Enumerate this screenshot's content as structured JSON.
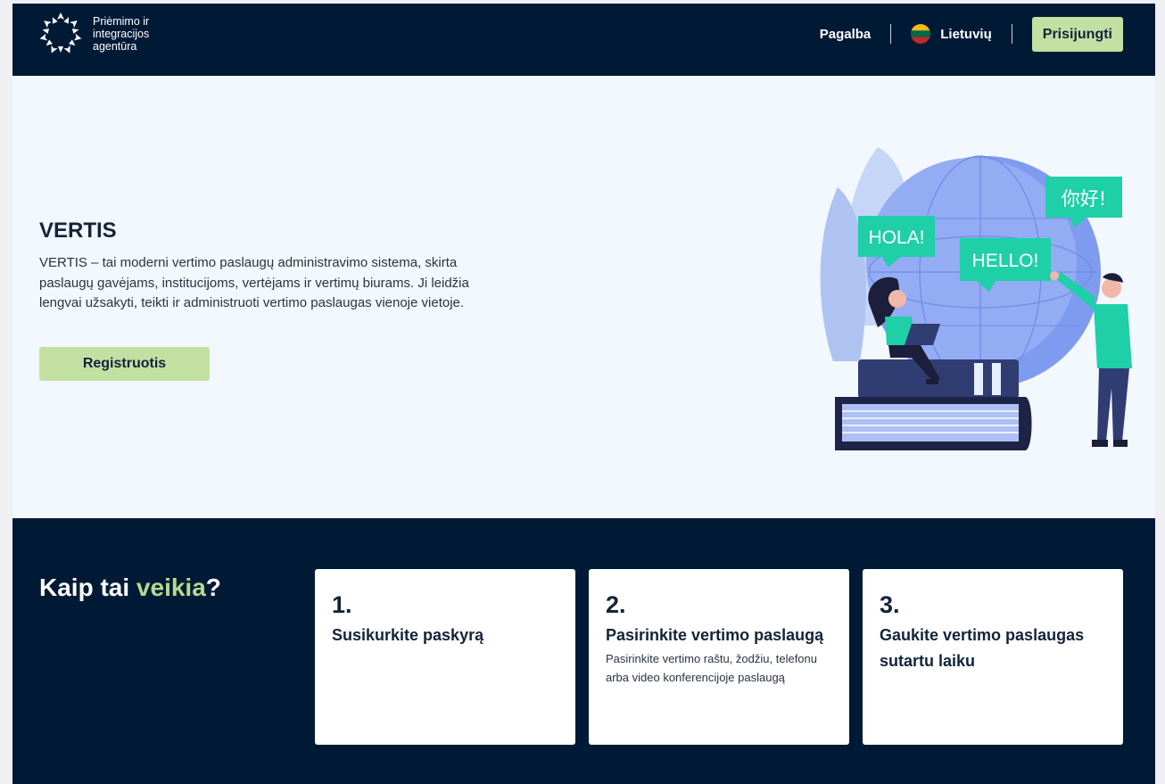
{
  "header": {
    "logo_text": "Priėmimo ir integracijos agentūra",
    "nav_help": "Pagalba",
    "language": "Lietuvių",
    "login": "Prisijungti"
  },
  "hero": {
    "title": "VERTIS",
    "description": "VERTIS – tai moderni vertimo paslaugų administravimo sistema, skirta paslaugų gavėjams, institucijoms, vertėjams ir vertimų biurams. Ji leidžia lengvai užsakyti, teikti ir administruoti vertimo paslaugas vienoje vietoje.",
    "register": "Registruotis",
    "bubbles": [
      "HOLA!",
      "HELLO!",
      "你好!"
    ]
  },
  "how": {
    "title_prefix": "Kaip tai ",
    "title_accent": "veikia",
    "title_suffix": "?",
    "cards": [
      {
        "num": "1.",
        "title": "Susikurkite paskyrą",
        "desc": ""
      },
      {
        "num": "2.",
        "title": "Pasirinkite vertimo paslaugą",
        "desc": "Pasirinkite vertimo raštu, žodžiu, telefonu arba video konferencijoje paslaugą"
      },
      {
        "num": "3.",
        "title": "Gaukite vertimo paslaugas sutartu laiku",
        "desc": ""
      }
    ]
  },
  "colors": {
    "navy": "#001a36",
    "accent_green": "#c3e0a3",
    "hero_bg": "#f3f7fe",
    "bubble_teal": "#1fcfa8"
  },
  "icons": {
    "logo": "agency-star-logo-icon",
    "flag": "lithuania-flag-icon"
  }
}
